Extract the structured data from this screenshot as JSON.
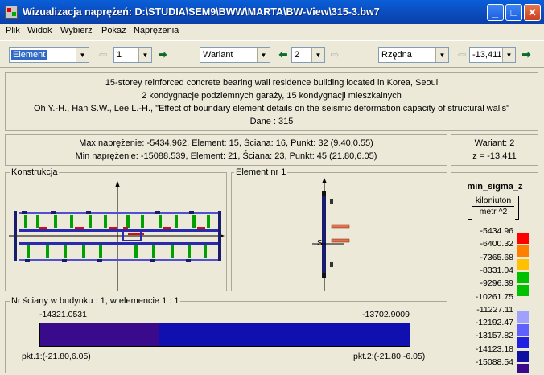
{
  "window": {
    "title": "Wizualizacja naprężeń: D:\\STUDIA\\SEM9\\BWW\\MARTA\\BW-View\\315-3.bw7",
    "minimize_glyph": "_",
    "maximize_glyph": "□",
    "close_glyph": "✕"
  },
  "menu": [
    "Plik",
    "Widok",
    "Wybierz",
    "Pokaż",
    "Naprężenia"
  ],
  "toolbar": {
    "element_combo": "Element",
    "element_number": "1",
    "variant_combo": "Wariant",
    "variant_number": "2",
    "ordinate_combo": "Rzędna",
    "ordinate_value": "-13,411"
  },
  "description": {
    "line1": "15-storey reinforced concrete bearing wall residence building located in Korea, Seoul",
    "line2": "2 kondygnacje podziemnych garaży, 15 kondygnacji mieszkalnych",
    "line3": "Oh Y.-H., Han S.W., Lee L.-H., \"Effect of boundary element details on the seismic deformation capacity of structural walls\"",
    "line4": "Dane :   315"
  },
  "stress_summary": {
    "max": "Max naprężenie: -5434.962,   Element: 15,   Ściana: 16,   Punkt: 32 (9.40,0.55)",
    "min": "Min naprężenie: -15088.539,   Element: 21,   Ściana: 23,   Punkt: 45 (21.80,6.05)"
  },
  "variant_info": {
    "variant": "Wariant: 2",
    "z": "z = -13.411"
  },
  "construction_panel": {
    "label": "Konstrukcja"
  },
  "element_panel": {
    "label": "Element nr 1",
    "axis_label": "S"
  },
  "wall_panel": {
    "label": "Nr ściany w budynku :  1,   w elemencie 1 :  1",
    "left_value": "-14321.0531",
    "right_value": "-13702.9009",
    "left_point": "pkt.1:(-21.80,6.05)",
    "right_point": "pkt.2:(-21.80,-6.05)",
    "left_fill": "#3a0a8c",
    "right_fill": "#1010b0",
    "split_fraction": 0.32
  },
  "legend": {
    "title": "min_sigma_z",
    "unit_num": "kiloniuton",
    "unit_den": "metr ^2",
    "values": [
      "-5434.96",
      "-6400.32",
      "-7365.68",
      "-8331.04",
      "-9296.39",
      "-10261.75",
      "-11227.11",
      "-12192.47",
      "-13157.82",
      "-14123.18",
      "-15088.54"
    ],
    "colors": [
      "#ff0000",
      "#ff8000",
      "#ffc000",
      "#00c000",
      "#00c000",
      "#ece9d8",
      "#a0a0ff",
      "#6060ff",
      "#2020e0",
      "#1010a0",
      "#3a0a8c"
    ]
  }
}
